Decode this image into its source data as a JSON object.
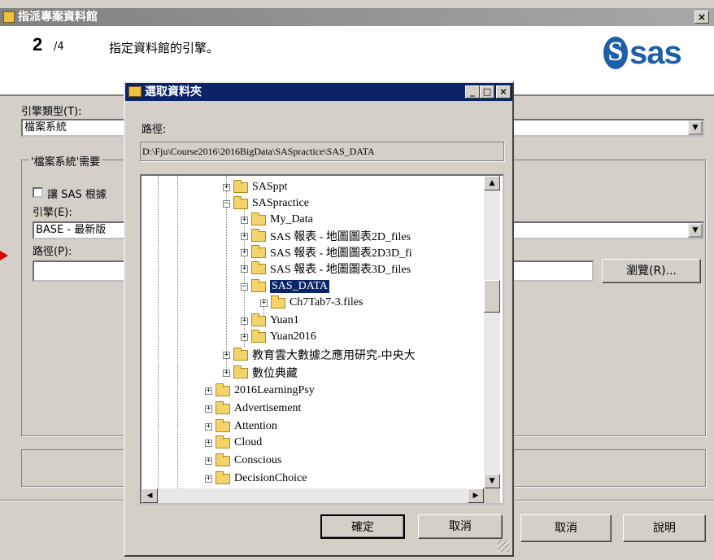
{
  "wizard": {
    "title": "指派專案資料館",
    "close": "×",
    "step_number": "2",
    "step_total": "/4",
    "step_description": "指定資料館的引擎。",
    "logo_text": "sas",
    "engine_type_label": "引擎類型(T):",
    "engine_type_value": "檔案系統",
    "group_label": "'檔案系統'需要",
    "sas_checkbox_label": "讓 SAS 根據",
    "engine_label": "引擎(E):",
    "engine_value": "BASE - 最新版",
    "path_label": "路徑(P):",
    "path_value": "",
    "browse_button": "瀏覽(R)...",
    "cancel_button": "取消",
    "help_button": "說明"
  },
  "dialog": {
    "title": "選取資料夾",
    "minimize": "_",
    "maximize": "□",
    "close": "×",
    "path_label": "路徑:",
    "path_value": "D:\\Fju\\Course2016\\2016BigData\\SASpractice\\SAS_DATA",
    "ok_button": "確定",
    "cancel_button": "取消",
    "tree": [
      {
        "label": "SASppt",
        "expander": "+"
      },
      {
        "label": "SASpractice",
        "expander": "−"
      },
      {
        "label": "My_Data",
        "expander": "+"
      },
      {
        "label": "SAS 報表 - 地圖圖表2D_files",
        "expander": "+"
      },
      {
        "label": "SAS 報表 - 地圖圖表2D3D_fi",
        "expander": "+"
      },
      {
        "label": "SAS 報表 - 地圖圖表3D_files",
        "expander": "+"
      },
      {
        "label": "SAS_DATA",
        "expander": "−"
      },
      {
        "label": "Ch7Tab7-3.files",
        "expander": "+"
      },
      {
        "label": "Yuan1",
        "expander": "+"
      },
      {
        "label": "Yuan2016",
        "expander": "+"
      },
      {
        "label": "教育雲大數據之應用研究-中央大",
        "expander": "+"
      },
      {
        "label": "數位典藏",
        "expander": "+"
      },
      {
        "label": "2016LearningPsy",
        "expander": "+"
      },
      {
        "label": "Advertisement",
        "expander": "+"
      },
      {
        "label": "Attention",
        "expander": "+"
      },
      {
        "label": "Cloud",
        "expander": "+"
      },
      {
        "label": "Conscious",
        "expander": "+"
      },
      {
        "label": "DecisionChoice",
        "expander": "+"
      }
    ]
  }
}
